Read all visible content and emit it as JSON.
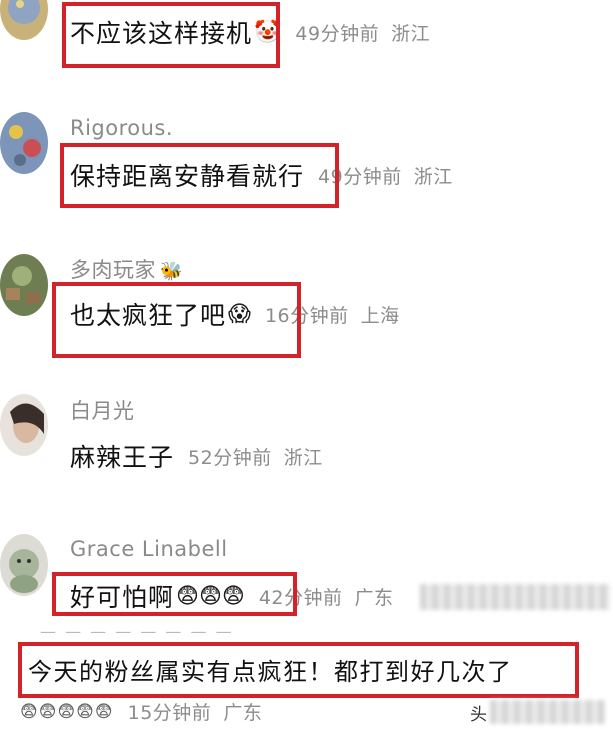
{
  "comments": [
    {
      "username": "",
      "text": "不应该这样接机",
      "emoji": "🤡",
      "time": "49分钟前",
      "location": "浙江"
    },
    {
      "username": "Rigorous.",
      "text": "保持距离安静看就行",
      "emoji": "",
      "time": "49分钟前",
      "location": "浙江"
    },
    {
      "username": "多肉玩家",
      "badge": "🐝",
      "text": "也太疯狂了吧",
      "emoji": "😱",
      "time": "16分钟前",
      "location": "上海"
    },
    {
      "username": "白月光",
      "text": "麻辣王子",
      "emoji": "",
      "time": "52分钟前",
      "location": "浙江"
    },
    {
      "username": "Grace Linabell",
      "text": "好可怕啊",
      "emoji": "😨😨😨",
      "time": "42分钟前",
      "location": "广东"
    },
    {
      "username": "",
      "text": "今天的粉丝属实有点疯狂！都打到好几次了",
      "emoji": "😨😨😨😨😨",
      "time": "15分钟前",
      "location": "广东"
    }
  ],
  "watermark": "头",
  "colors": {
    "highlight": "#d2232a",
    "meta": "#8c8c8c",
    "username": "#8a8a8a"
  }
}
